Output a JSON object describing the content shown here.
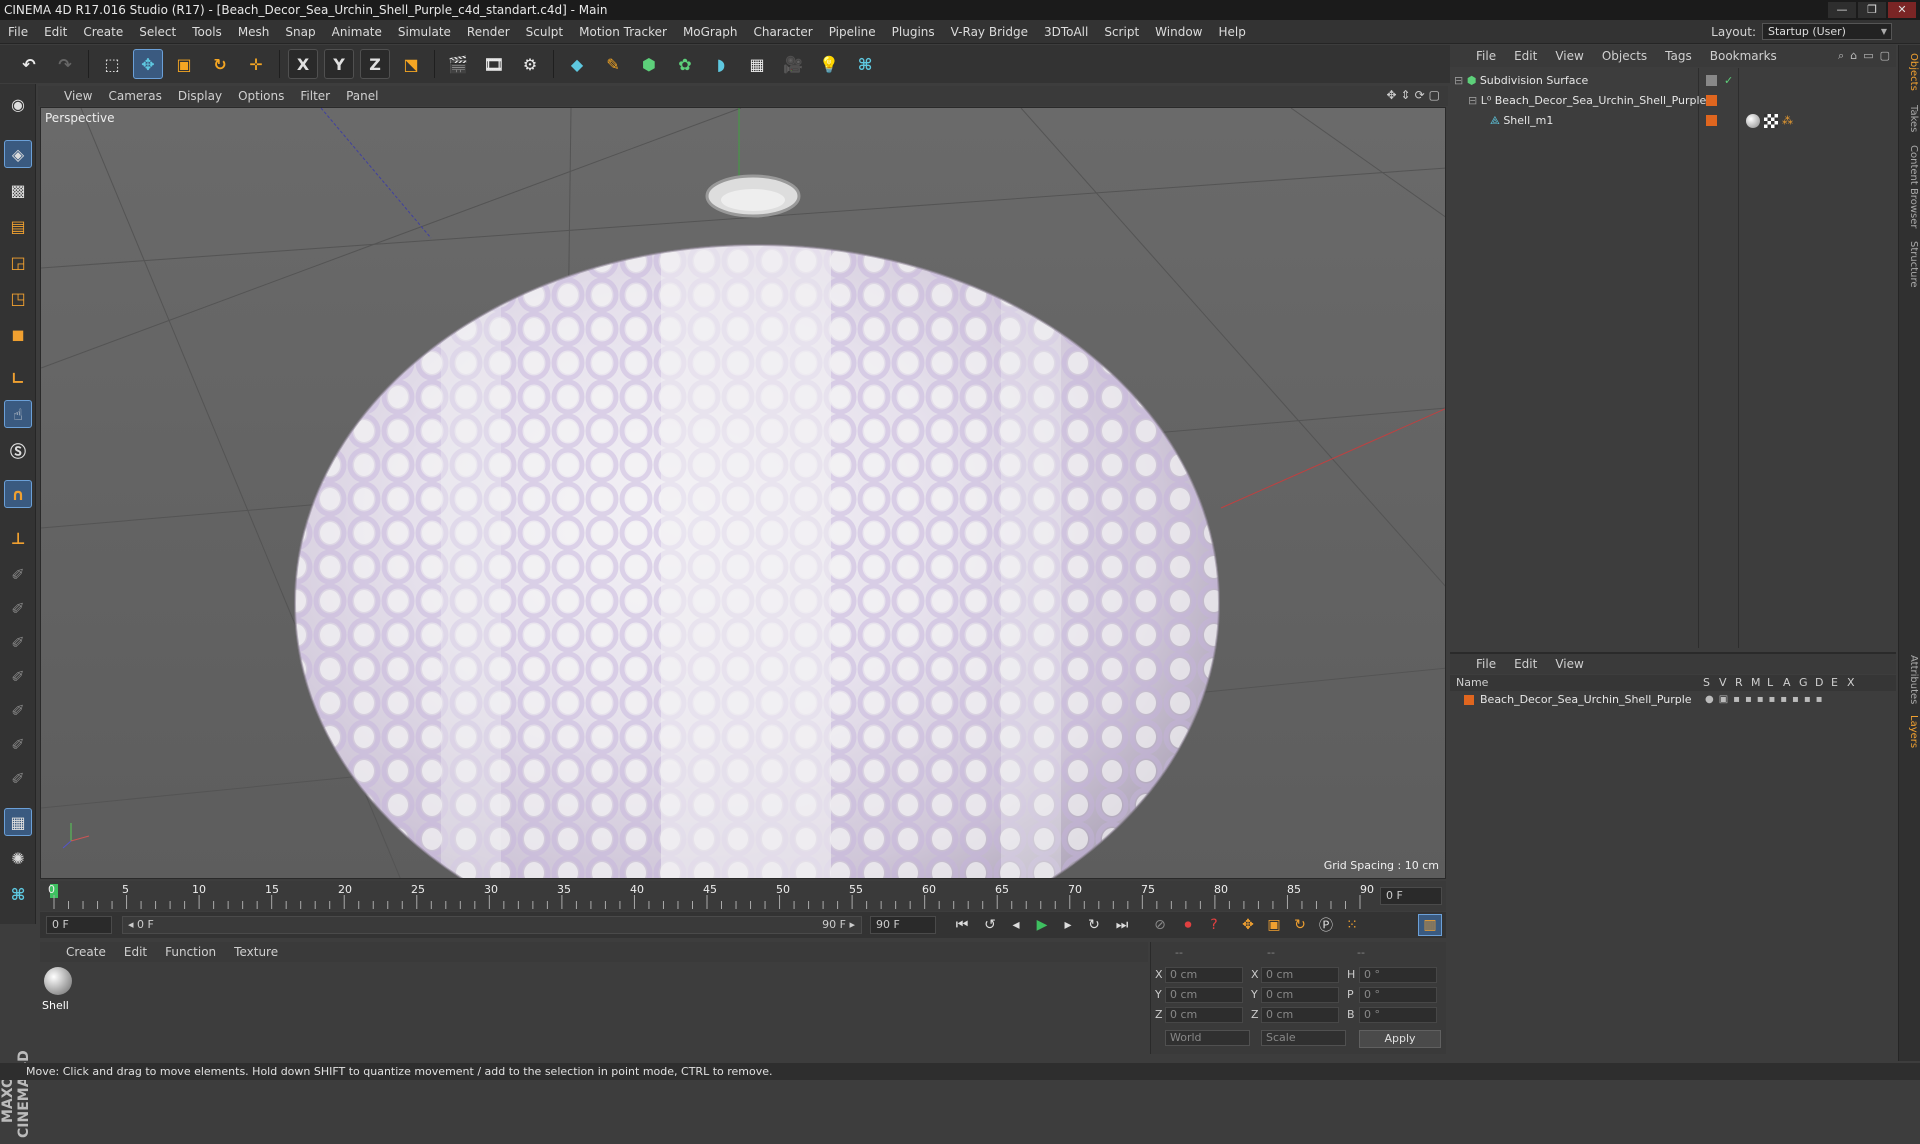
{
  "window": {
    "title": "CINEMA 4D R17.016 Studio (R17) - [Beach_Decor_Sea_Urchin_Shell_Purple_c4d_standart.c4d] - Main",
    "buttons": [
      "—",
      "❐",
      "✕"
    ]
  },
  "menubar": {
    "items": [
      "File",
      "Edit",
      "Create",
      "Select",
      "Tools",
      "Mesh",
      "Snap",
      "Animate",
      "Simulate",
      "Render",
      "Sculpt",
      "Motion Tracker",
      "MoGraph",
      "Character",
      "Pipeline",
      "Plugins",
      "V-Ray Bridge",
      "3DToAll",
      "Script",
      "Window",
      "Help"
    ],
    "layout_label": "Layout:",
    "layout_value": "Startup (User)"
  },
  "toolbar": {
    "axis_x": "X",
    "axis_y": "Y",
    "axis_z": "Z"
  },
  "viewport": {
    "menu": [
      "View",
      "Cameras",
      "Display",
      "Options",
      "Filter",
      "Panel"
    ],
    "label": "Perspective",
    "grid_spacing": "Grid Spacing : 10 cm",
    "axis_labels": {
      "x": "x",
      "y": "y",
      "z": "z"
    }
  },
  "timeline": {
    "ticks": [
      "0",
      "5",
      "10",
      "15",
      "20",
      "25",
      "30",
      "35",
      "40",
      "45",
      "50",
      "55",
      "60",
      "65",
      "70",
      "75",
      "80",
      "85",
      "90"
    ],
    "current_frame": "0 F",
    "start_field": "0 F",
    "range_start": "◂ 0 F",
    "range_end": "90 F ▸",
    "end_field": "90 F"
  },
  "material_manager": {
    "menu": [
      "Create",
      "Edit",
      "Function",
      "Texture"
    ],
    "materials": [
      {
        "name": "Shell"
      }
    ]
  },
  "coordinates": {
    "headers": [
      "--",
      "--",
      "--"
    ],
    "rows": [
      {
        "pos_label": "X",
        "pos": "0 cm",
        "size_label": "X",
        "size": "0 cm",
        "rot_label": "H",
        "rot": "0 °"
      },
      {
        "pos_label": "Y",
        "pos": "0 cm",
        "size_label": "Y",
        "size": "0 cm",
        "rot_label": "P",
        "rot": "0 °"
      },
      {
        "pos_label": "Z",
        "pos": "0 cm",
        "size_label": "Z",
        "size": "0 cm",
        "rot_label": "B",
        "rot": "0 °"
      }
    ],
    "mode_world": "World",
    "mode_scale": "Scale",
    "apply": "Apply"
  },
  "status": {
    "text": "Move: Click and drag to move elements. Hold down SHIFT to quantize movement / add to the selection in point mode, CTRL to remove."
  },
  "object_manager": {
    "menu": [
      "File",
      "Edit",
      "View",
      "Objects",
      "Tags",
      "Bookmarks"
    ],
    "objects": [
      {
        "name": "Subdivision Surface"
      },
      {
        "name": "Beach_Decor_Sea_Urchin_Shell_Purple"
      },
      {
        "name": "Shell_m1"
      }
    ]
  },
  "layer_manager": {
    "menu": [
      "File",
      "Edit",
      "View"
    ],
    "columns": [
      "Name",
      "S",
      "V",
      "R",
      "M",
      "L",
      "A",
      "G",
      "D",
      "E",
      "X"
    ],
    "layers": [
      {
        "name": "Beach_Decor_Sea_Urchin_Shell_Purple"
      }
    ]
  },
  "right_tabs": [
    "Objects",
    "Takes",
    "Content Browser",
    "Structure",
    "Attributes",
    "Layers"
  ],
  "logo": "MAXON CINEMA 4D",
  "colors": {
    "accent_orange": "#f0a030",
    "active_blue": "#3a5a80",
    "layer_tag": "#e0661f"
  }
}
